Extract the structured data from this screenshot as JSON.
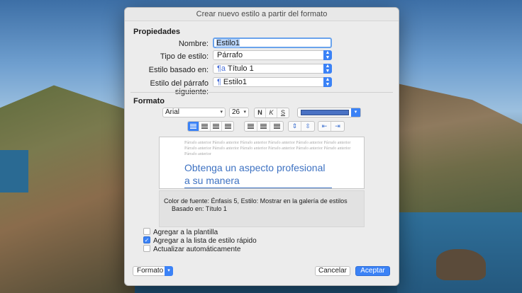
{
  "dialog": {
    "title": "Crear nuevo estilo a partir del formato",
    "sections": {
      "properties": "Propiedades",
      "format": "Formato"
    },
    "properties": {
      "name_label": "Nombre:",
      "name_value": "Estilo1",
      "style_type_label": "Tipo de estilo:",
      "style_type_value": "Párrafo",
      "based_on_label": "Estilo basado en:",
      "based_on_value": "Título 1",
      "based_on_glyph": "¶a",
      "next_para_label": "Estilo del párrafo siguiente:",
      "next_para_value": "Estilo1",
      "next_para_glyph": "¶"
    },
    "format": {
      "font": "Arial",
      "size": "26",
      "bold": "N",
      "italic": "K",
      "underline": "S",
      "font_color": "#4a72c4"
    },
    "preview": {
      "previous_text": "Párrafo anterior Párrafo anterior Párrafo anterior Párrafo anterior Párrafo anterior Párrafo anterior Párrafo anterior Párrafo anterior Párrafo anterior Párrafo anterior Párrafo anterior Párrafo anterior Párrafo anterior",
      "heading_line1": "Obtenga un aspecto profesional",
      "heading_line2": "a su manera"
    },
    "description": {
      "line1": "Color de fuente: Énfasis 5, Estilo: Mostrar en la galería de estilos",
      "line2": "Basado en: Título 1"
    },
    "options": {
      "add_template": "Agregar a la plantilla",
      "add_template_checked": false,
      "add_quick": "Agregar a la lista de estilo rápido",
      "add_quick_checked": true,
      "auto_update": "Actualizar automáticamente",
      "auto_update_checked": false
    },
    "footer": {
      "format_label": "Formato",
      "cancel_label": "Cancelar",
      "accept_label": "Aceptar"
    }
  }
}
